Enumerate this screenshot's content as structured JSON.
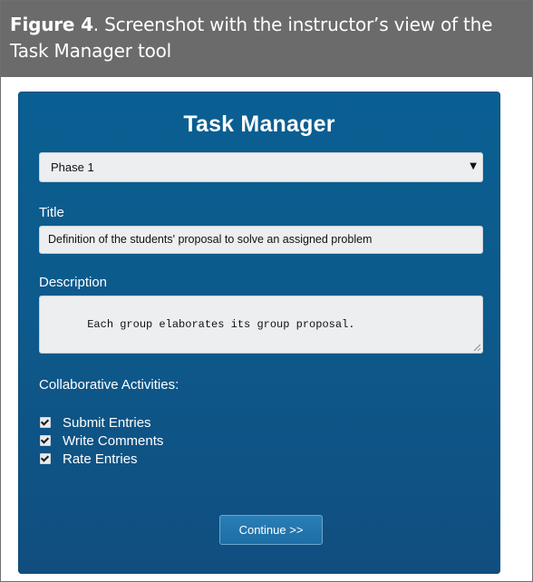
{
  "caption": {
    "label": "Figure 4",
    "text": ". Screenshot with the instructor’s view of the Task Manager tool"
  },
  "task_manager": {
    "title": "Task Manager",
    "phase_select": {
      "selected": "Phase 1",
      "arrow_icon": "triangle-down"
    },
    "title_field": {
      "label": "Title",
      "value": "Definition of the students' proposal to solve an assigned problem"
    },
    "description_field": {
      "label": "Description",
      "value": "Each group elaborates its group proposal."
    },
    "activities": {
      "label": "Collaborative Activities:",
      "items": [
        {
          "label": "Submit Entries",
          "checked": true
        },
        {
          "label": "Write Comments",
          "checked": true
        },
        {
          "label": "Rate Entries",
          "checked": true
        }
      ]
    },
    "continue_button": {
      "label": "Continue >>"
    }
  },
  "colors": {
    "caption_bg": "#6b6b6b",
    "panel_bg": "#0d5a8c",
    "field_bg": "#eceef0",
    "button_bg": "#2276ad"
  }
}
